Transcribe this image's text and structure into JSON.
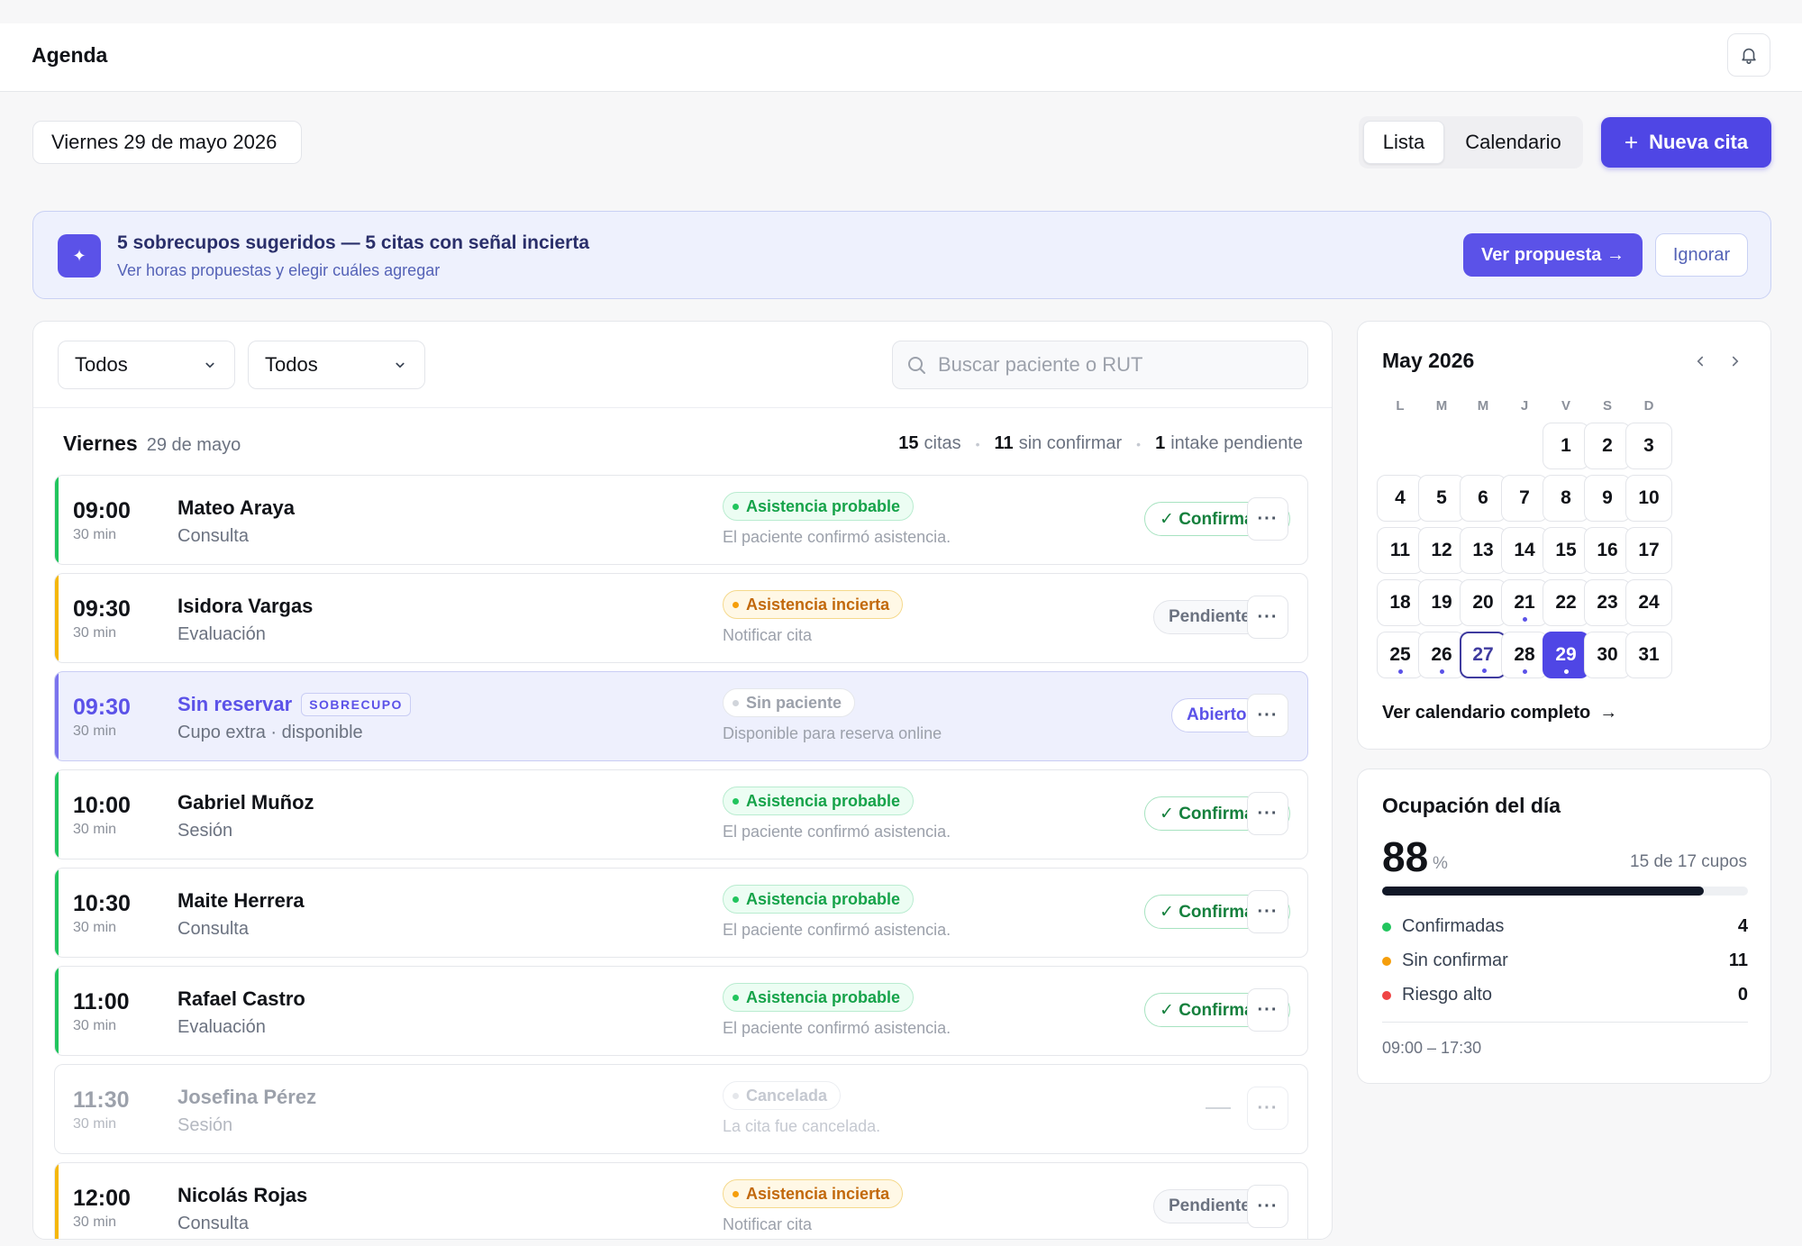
{
  "header": {
    "title": "Agenda"
  },
  "toolbar": {
    "date_label": "Viernes 29 de mayo 2026",
    "view_options": [
      "Lista",
      "Calendario"
    ],
    "active_view": "Lista",
    "new_button": "Nueva cita"
  },
  "banner": {
    "title": "5 sobrecupos sugeridos — 5 citas con señal incierta",
    "subtitle": "Ver horas propuestas y elegir cuáles agregar",
    "primary_action": "Ver propuesta →",
    "secondary_action": "Ignorar"
  },
  "filters": {
    "select_1": "Todos",
    "select_2": "Todos",
    "search_placeholder": "Buscar paciente o RUT"
  },
  "day": {
    "weekday": "Viernes",
    "date": "29 de mayo",
    "stats": [
      {
        "value": "15",
        "label": "citas"
      },
      {
        "value": "11",
        "label": "sin confirmar"
      },
      {
        "value": "1",
        "label": "intake pendiente"
      }
    ]
  },
  "appointments": [
    {
      "time": "09:00",
      "duration": "30 min",
      "name": "Mateo Araya",
      "type": "Consulta",
      "signal": "Asistencia probable",
      "note": "El paciente confirmó asistencia.",
      "status": "✓ Confirmado"
    },
    {
      "time": "09:30",
      "duration": "30 min",
      "name": "Isidora Vargas",
      "type": "Evaluación",
      "signal": "Asistencia incierta",
      "note": "Notificar cita",
      "status": "Pendiente"
    },
    {
      "time": "09:30",
      "duration": "30 min",
      "name": "Sin reservar",
      "tag": "SOBRECUPO",
      "type": "Cupo extra · disponible",
      "signal": "Sin paciente",
      "note": "Disponible para reserva online",
      "status": "Abierto"
    },
    {
      "time": "10:00",
      "duration": "30 min",
      "name": "Gabriel Muñoz",
      "type": "Sesión",
      "signal": "Asistencia probable",
      "note": "El paciente confirmó asistencia.",
      "status": "✓ Confirmado"
    },
    {
      "time": "10:30",
      "duration": "30 min",
      "name": "Maite Herrera",
      "type": "Consulta",
      "signal": "Asistencia probable",
      "note": "El paciente confirmó asistencia.",
      "status": "✓ Confirmado"
    },
    {
      "time": "11:00",
      "duration": "30 min",
      "name": "Rafael Castro",
      "type": "Evaluación",
      "signal": "Asistencia probable",
      "note": "El paciente confirmó asistencia.",
      "status": "✓ Confirmado"
    },
    {
      "time": "11:30",
      "duration": "30 min",
      "name": "Josefina Pérez",
      "type": "Sesión",
      "signal": "Cancelada",
      "note": "La cita fue cancelada.",
      "status": ""
    },
    {
      "time": "12:00",
      "duration": "30 min",
      "name": "Nicolás Rojas",
      "type": "Consulta",
      "signal": "Asistencia incierta",
      "note": "Notificar cita",
      "status": "Pendiente"
    }
  ],
  "calendar": {
    "month_label": "May 2026",
    "weekdays": [
      "L",
      "M",
      "M",
      "J",
      "V",
      "S",
      "D"
    ],
    "days": [
      "1",
      "2",
      "3",
      "4",
      "5",
      "6",
      "7",
      "8",
      "9",
      "10",
      "11",
      "12",
      "13",
      "14",
      "15",
      "16",
      "17",
      "18",
      "19",
      "20",
      "21",
      "22",
      "23",
      "24",
      "25",
      "26",
      "27",
      "28",
      "29",
      "30",
      "31"
    ],
    "today": "27",
    "selected": "29",
    "days_with_events": [
      "21",
      "25",
      "26",
      "27",
      "28",
      "29"
    ],
    "full_link": "Ver calendario completo"
  },
  "occupancy": {
    "title": "Ocupación del día",
    "percent": "88",
    "percent_unit": "%",
    "capacity": "15 de 17 cupos",
    "fill_percent": 88,
    "breakdown": [
      {
        "label": "Confirmadas",
        "value": "4",
        "color": "#22c55e"
      },
      {
        "label": "Sin confirmar",
        "value": "11",
        "color": "#f59e0b"
      },
      {
        "label": "Riesgo alto",
        "value": "0",
        "color": "#ef4444"
      }
    ],
    "hours": "09:00 – 17:30"
  },
  "colors": {
    "accent": "#4f46e5",
    "confirmed": "#22c55e",
    "pending": "#f5b70a"
  }
}
